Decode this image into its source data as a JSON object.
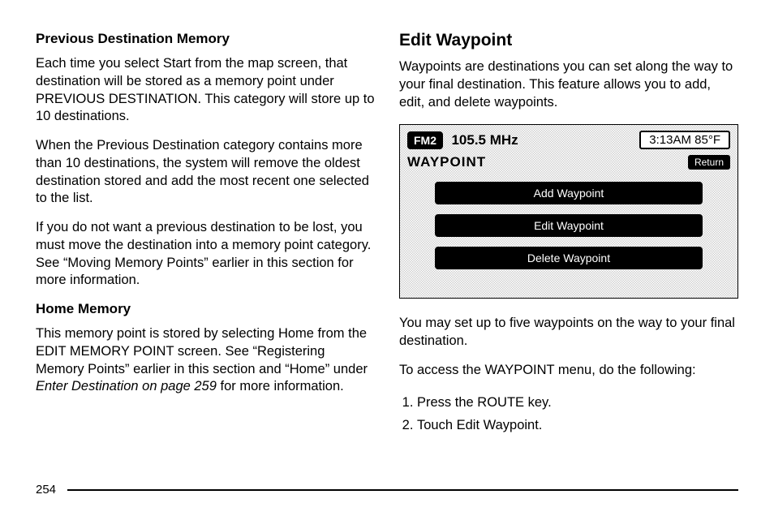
{
  "left": {
    "h_prev": "Previous Destination Memory",
    "p_prev1": "Each time you select Start from the map screen, that destination will be stored as a memory point under PREVIOUS DESTINATION. This category will store up to 10 destinations.",
    "p_prev2": "When the Previous Destination category contains more than 10 destinations, the system will remove the oldest destination stored and add the most recent one selected to the list.",
    "p_prev3": "If you do not want a previous destination to be lost, you must move the destination into a memory point category. See “Moving Memory Points” earlier in this section for more information.",
    "h_home": "Home Memory",
    "p_home_a": "This memory point is stored by selecting Home from the EDIT MEMORY POINT screen. See “Registering Memory Points” earlier in this section and “Home” under ",
    "p_home_ital": "Enter Destination on page 259",
    "p_home_b": " for more information."
  },
  "right": {
    "h_edit": "Edit Waypoint",
    "p_intro": "Waypoints are destinations you can set along the way to your final destination. This feature allows you to add, edit, and delete waypoints.",
    "p_five": "You may set up to five waypoints on the way to your final destination.",
    "p_access": "To access the WAYPOINT menu, do the following:",
    "steps": [
      "Press the ROUTE key.",
      "Touch Edit Waypoint."
    ]
  },
  "device": {
    "band": "FM2",
    "freq": "105.5 MHz",
    "status": "3:13AM 85°F",
    "title": "WAYPOINT",
    "return": "Return",
    "btn_add": "Add Waypoint",
    "btn_edit": "Edit Waypoint",
    "btn_delete": "Delete Waypoint"
  },
  "page_number": "254"
}
